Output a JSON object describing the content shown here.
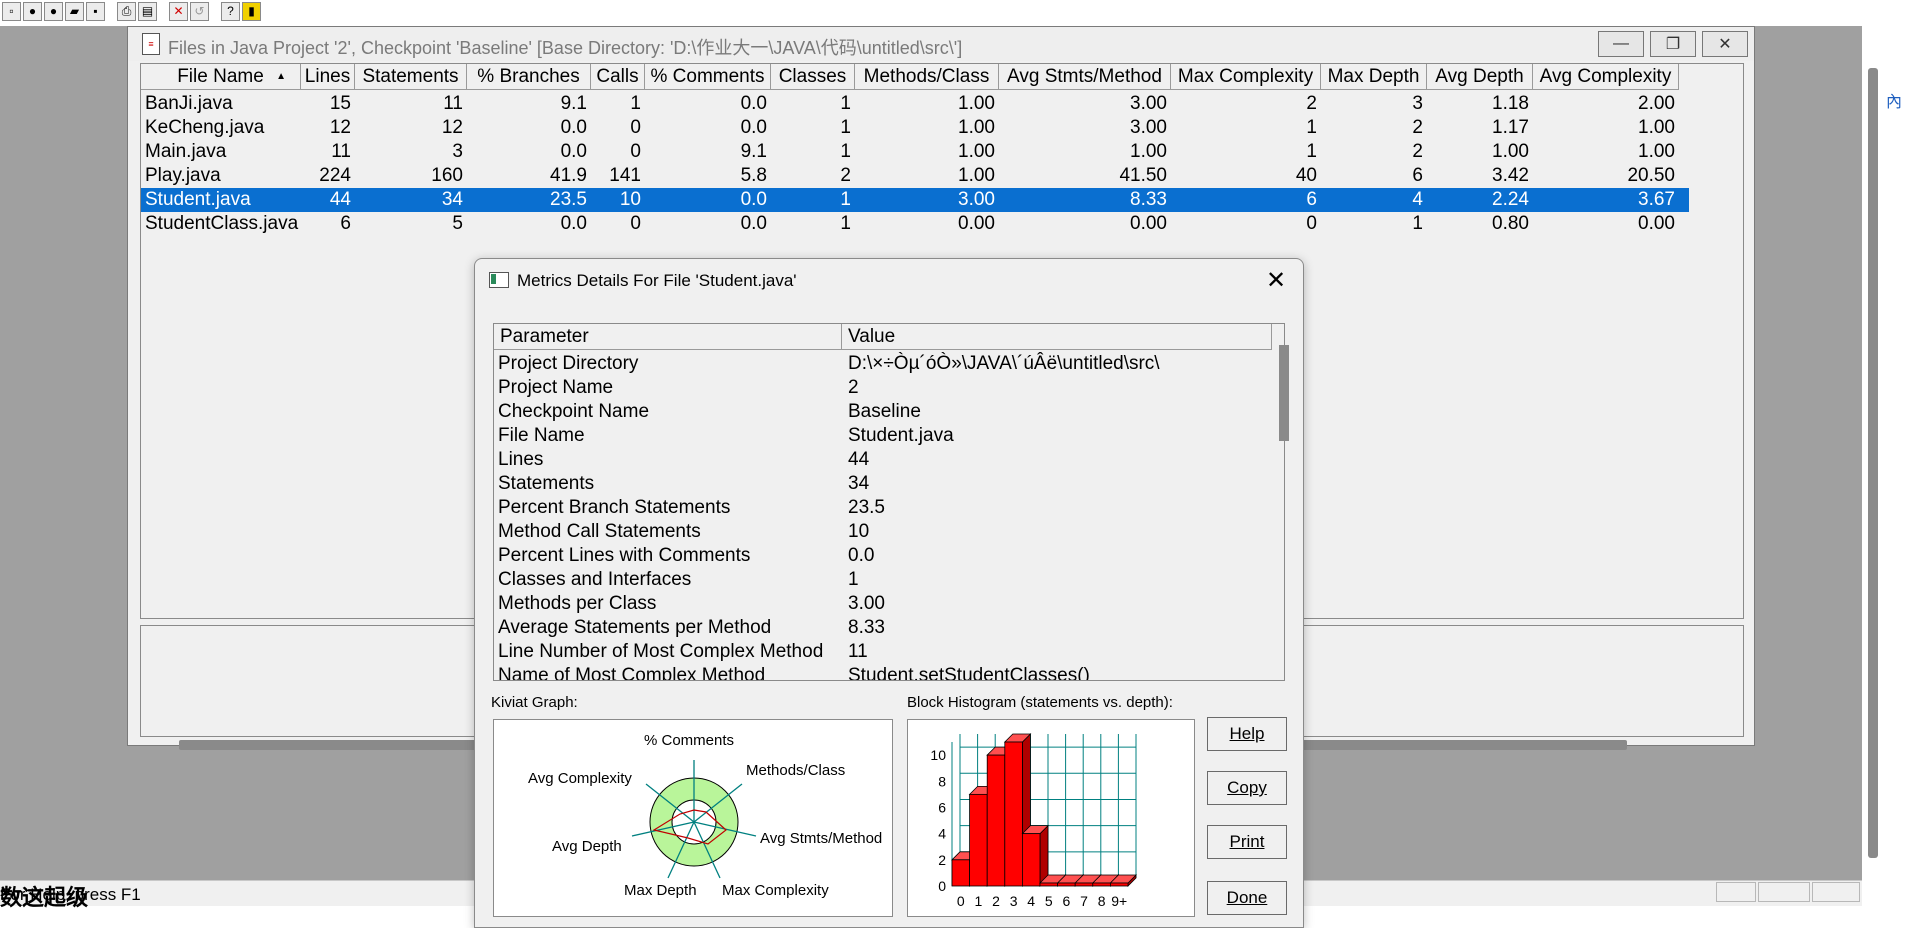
{
  "toolbar": {
    "icons": [
      "new-icon",
      "record-icon",
      "record-all-icon",
      "open-icon",
      "save-icon",
      "print-icon",
      "print-preview-icon",
      "delete-icon",
      "undo-icon",
      "context-help-icon",
      "exit-icon"
    ]
  },
  "files_window": {
    "title": "Files in Java Project '2', Checkpoint 'Baseline'  [Base Directory: 'D:\\作业大一\\JAVA\\代码\\untitled\\src\\']",
    "columns": [
      "File Name",
      "Lines",
      "Statements",
      "% Branches",
      "Calls",
      "% Comments",
      "Classes",
      "Methods/Class",
      "Avg Stmts/Method",
      "Max Complexity",
      "Max Depth",
      "Avg Depth",
      "Avg Complexity"
    ],
    "rows": [
      [
        "BanJi.java",
        "15",
        "11",
        "9.1",
        "1",
        "0.0",
        "1",
        "1.00",
        "3.00",
        "2",
        "3",
        "1.18",
        "2.00"
      ],
      [
        "KeCheng.java",
        "12",
        "12",
        "0.0",
        "0",
        "0.0",
        "1",
        "1.00",
        "3.00",
        "1",
        "2",
        "1.17",
        "1.00"
      ],
      [
        "Main.java",
        "11",
        "3",
        "0.0",
        "0",
        "9.1",
        "1",
        "1.00",
        "1.00",
        "1",
        "2",
        "1.00",
        "1.00"
      ],
      [
        "Play.java",
        "224",
        "160",
        "41.9",
        "141",
        "5.8",
        "2",
        "1.00",
        "41.50",
        "40",
        "6",
        "3.42",
        "20.50"
      ],
      [
        "Student.java",
        "44",
        "34",
        "23.5",
        "10",
        "0.0",
        "1",
        "3.00",
        "8.33",
        "6",
        "4",
        "2.24",
        "3.67"
      ],
      [
        "StudentClass.java",
        "6",
        "5",
        "0.0",
        "0",
        "0.0",
        "1",
        "0.00",
        "0.00",
        "0",
        "1",
        "0.80",
        "0.00"
      ]
    ],
    "selected_row": 4
  },
  "dialog": {
    "title": "Metrics Details For File 'Student.java'",
    "table_header": [
      "Parameter",
      "Value"
    ],
    "params": [
      [
        "Project Directory",
        "D:\\×÷Òµ´óÒ»\\JAVA\\´úÂë\\untitled\\src\\"
      ],
      [
        "Project Name",
        "2"
      ],
      [
        "Checkpoint Name",
        "Baseline"
      ],
      [
        "File Name",
        "Student.java"
      ],
      [
        "Lines",
        "44"
      ],
      [
        "Statements",
        "34"
      ],
      [
        "Percent Branch Statements",
        "23.5"
      ],
      [
        "Method Call Statements",
        "10"
      ],
      [
        "Percent Lines with Comments",
        "0.0"
      ],
      [
        "Classes and Interfaces",
        "1"
      ],
      [
        "Methods per Class",
        "3.00"
      ],
      [
        "Average Statements per Method",
        "8.33"
      ],
      [
        "Line Number of Most Complex Method",
        "11"
      ],
      [
        "Name of Most Complex Method",
        "Student.setStudentClasses()"
      ]
    ],
    "kiviat_label": "Kiviat Graph:",
    "kiviat_axes": [
      "% Comments",
      "Methods/Class",
      "Avg Stmts/Method",
      "Max Complexity",
      "Max Depth",
      "Avg Depth",
      "Avg Complexity"
    ],
    "histogram_label": "Block Histogram (statements vs. depth):",
    "buttons": {
      "help": "Help",
      "copy": "Copy",
      "print": "Print",
      "done": "Done"
    }
  },
  "chart_data": {
    "type": "bar",
    "title": "Block Histogram (statements vs. depth):",
    "categories": [
      "0",
      "1",
      "2",
      "3",
      "4",
      "5",
      "6",
      "7",
      "8",
      "9+"
    ],
    "values": [
      2,
      7,
      10,
      11,
      4,
      0,
      0,
      0,
      0,
      0
    ],
    "y_ticks": [
      "0",
      "2",
      "4",
      "6",
      "8",
      "10"
    ],
    "ylim": [
      0,
      11
    ],
    "grid": true,
    "bar_color": "#ff0000",
    "grid_color": "#008080"
  },
  "status": {
    "text": "For Help, press F1",
    "bottom_text": "数这起级"
  },
  "right_panel": {
    "glyph": "內"
  }
}
